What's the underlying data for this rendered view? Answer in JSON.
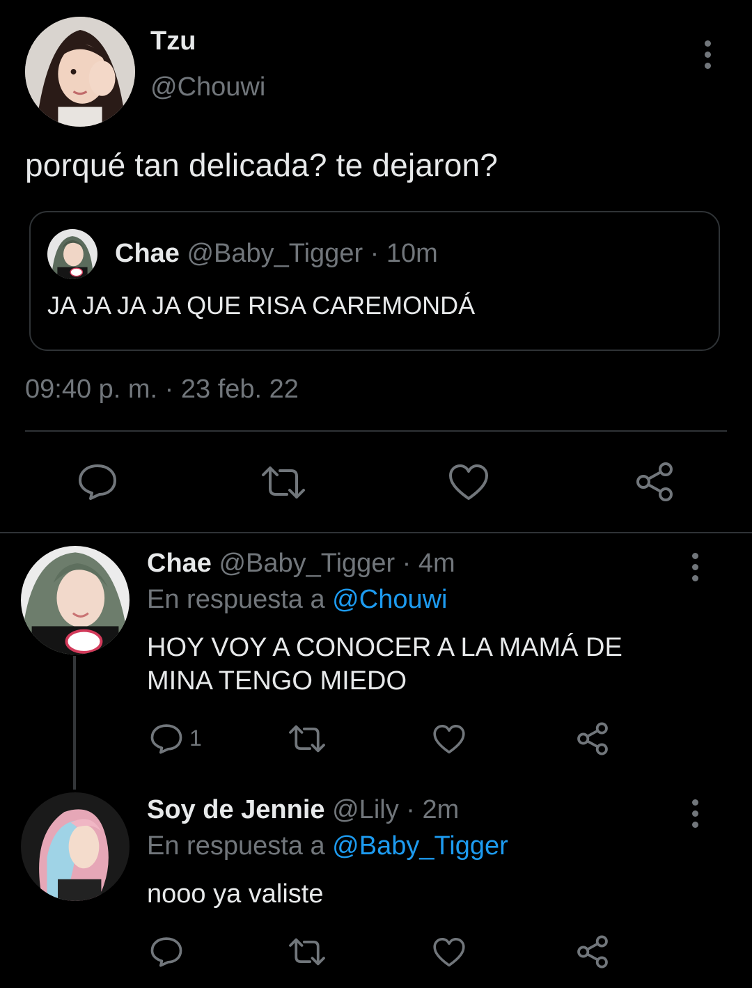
{
  "main_tweet": {
    "name": "Tzu",
    "handle": "@Chouwi",
    "text": "porqué tan delicada? te dejaron?",
    "timestamp": "09:40 p. m. · 23 feb. 22",
    "quoted": {
      "name": "Chae",
      "handle": "@Baby_Tigger",
      "time": "· 10m",
      "text": "JA JA JA JA QUE RISA CAREMONDÁ"
    },
    "actions": [
      "reply-icon",
      "retweet-icon",
      "like-icon",
      "share-icon"
    ]
  },
  "replies": [
    {
      "name": "Chae",
      "handle": "@Baby_Tigger",
      "time": "· 4m",
      "reply_prefix": "En respuesta a",
      "reply_to": "@Chouwi",
      "text": "HOY VOY A CONOCER A LA MAMÁ DE MINA TENGO MIEDO",
      "reply_count": "1"
    },
    {
      "name": "Soy de Jennie",
      "handle": "@Lily",
      "time": "· 2m",
      "reply_prefix": "En respuesta a",
      "reply_to": "@Baby_Tigger",
      "text": "nooo ya valiste",
      "reply_count": ""
    }
  ],
  "colors": {
    "background": "#000000",
    "text": "#e7e9ea",
    "secondary": "#71767b",
    "accent": "#1d9bf0",
    "border": "#2f3336"
  }
}
